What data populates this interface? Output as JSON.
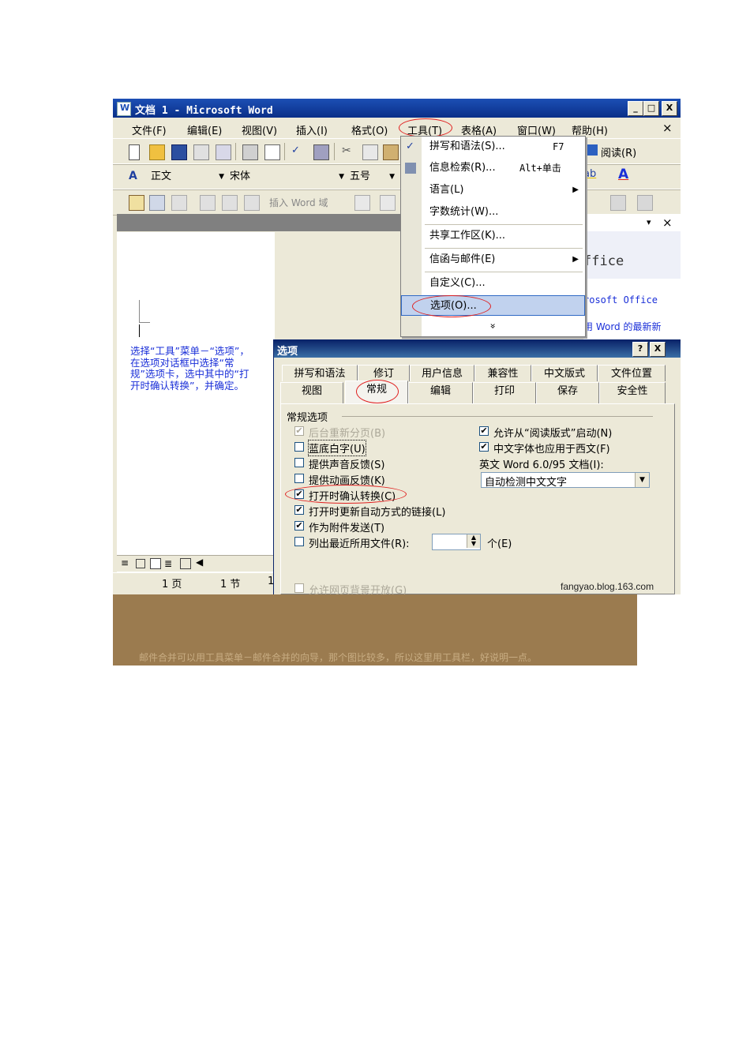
{
  "window": {
    "title": "文档 1 - Microsoft Word",
    "btn_min": "_",
    "btn_max": "□",
    "btn_close": "X"
  },
  "menubar": {
    "items": [
      "文件(F)",
      "编辑(E)",
      "视图(V)",
      "插入(I)",
      "格式(O)",
      "工具(T)",
      "表格(A)",
      "窗口(W)",
      "帮助(H)"
    ],
    "close": "×"
  },
  "toolbar": {
    "reading": "阅读(R)",
    "style": "正文",
    "font": "宋体",
    "size": "五号",
    "insert_field": "插入 Word 域",
    "font_color_glyph": "A",
    "highlight_glyph": "ab"
  },
  "task_pane": {
    "line1": "ffice",
    "line2": "rosoft Office",
    "line3": "用 Word 的最新新",
    "btn_dropdown": "▾",
    "btn_close": "×"
  },
  "tools_menu": {
    "items": [
      {
        "label": "拼写和语法(S)...",
        "shortcut": "F7"
      },
      {
        "label": "信息检索(R)...",
        "shortcut": "Alt+单击"
      },
      {
        "label": "语言(L)",
        "submenu": "▶"
      },
      {
        "label": "字数统计(W)..."
      },
      {
        "label": "共享工作区(K)..."
      },
      {
        "label": "信函与邮件(E)",
        "submenu": "▶"
      },
      {
        "label": "自定义(C)..."
      },
      {
        "label": "选项(O)..."
      }
    ],
    "expand": "»"
  },
  "annotation": "选择“工具”菜单－“选项”，在选项对话框中选择“常规”选项卡，选中其中的“打开时确认转换”，并确定。",
  "dialog": {
    "title": "选项",
    "help": "?",
    "close": "X",
    "tabs_row1": [
      "拼写和语法",
      "修订",
      "用户信息",
      "兼容性",
      "中文版式",
      "文件位置"
    ],
    "tabs_row2": [
      "视图",
      "常规",
      "编辑",
      "打印",
      "保存",
      "安全性"
    ],
    "group": "常规选项",
    "left_options": [
      {
        "label": "后台重新分页(B)",
        "checked": "✔",
        "disabled": true
      },
      {
        "label": "蓝底白字(U)",
        "checked": ""
      },
      {
        "label": "提供声音反馈(S)",
        "checked": ""
      },
      {
        "label": "提供动画反馈(K)",
        "checked": ""
      },
      {
        "label": "打开时确认转换(C)",
        "checked": "✔"
      },
      {
        "label": "打开时更新自动方式的链接(L)",
        "checked": "✔"
      },
      {
        "label": "作为附件发送(T)",
        "checked": "✔"
      },
      {
        "label": "列出最近所用文件(R):",
        "checked": ""
      }
    ],
    "recent_unit": "个(E)",
    "right_options": [
      {
        "label": "允许从“阅读版式”启动(N)",
        "checked": "✔"
      },
      {
        "label": "中文字体也应用于西文(F)",
        "checked": "✔"
      }
    ],
    "word6_label": "英文 Word 6.0/95 文档(I):",
    "word6_value": "自动检测中文文字",
    "bottom_option": {
      "label": "允许网页背景开放(G)",
      "checked": ""
    }
  },
  "statusbar": {
    "page": "1 页",
    "section": "1 节",
    "extra": "1"
  },
  "watermark": "fangyao.blog.163.com",
  "caption": "邮件合并可以用工具菜单－邮件合并的向导，那个图比较多，所以这里用工具栏，好说明一点。"
}
